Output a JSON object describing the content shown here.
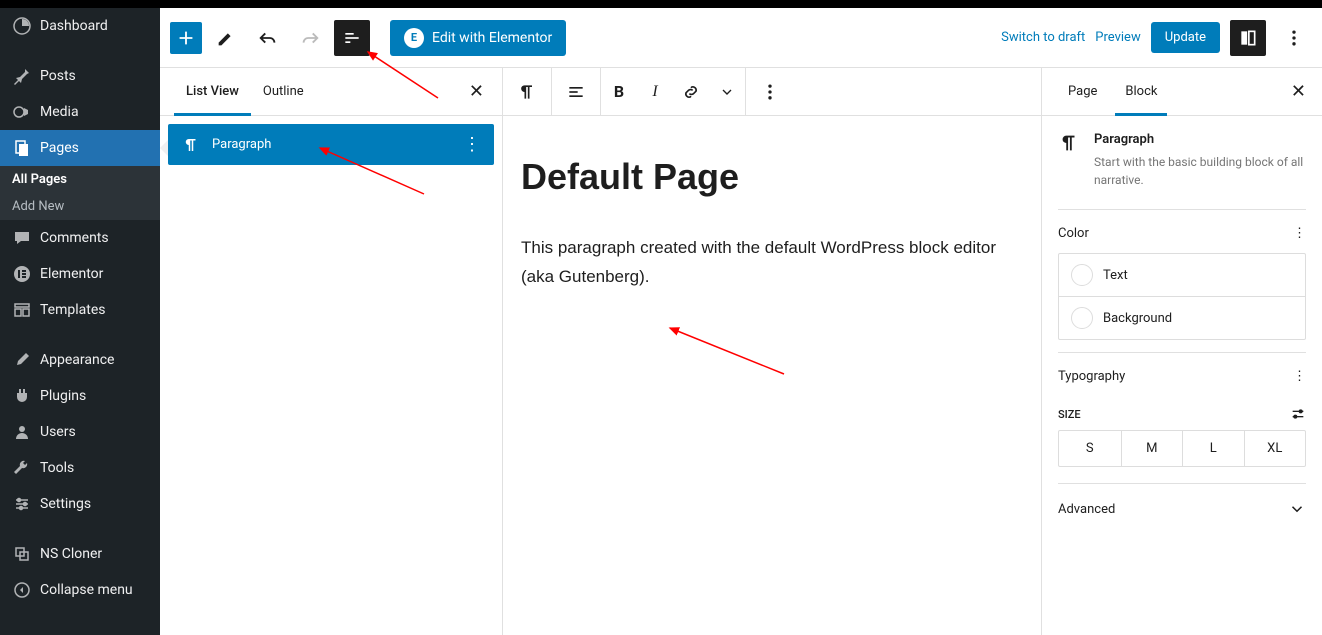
{
  "admin": {
    "items": [
      {
        "name": "dashboard",
        "label": "Dashboard",
        "icon": "dashboard"
      },
      {
        "name": "posts",
        "label": "Posts",
        "icon": "pin"
      },
      {
        "name": "media",
        "label": "Media",
        "icon": "media"
      },
      {
        "name": "pages",
        "label": "Pages",
        "icon": "pages",
        "active": true,
        "sub": [
          {
            "label": "All Pages",
            "current": true
          },
          {
            "label": "Add New"
          }
        ]
      },
      {
        "name": "comments",
        "label": "Comments",
        "icon": "comment"
      },
      {
        "name": "elementor",
        "label": "Elementor",
        "icon": "elementor"
      },
      {
        "name": "templates",
        "label": "Templates",
        "icon": "templates"
      },
      {
        "gap": true
      },
      {
        "name": "appearance",
        "label": "Appearance",
        "icon": "brush"
      },
      {
        "name": "plugins",
        "label": "Plugins",
        "icon": "plug"
      },
      {
        "name": "users",
        "label": "Users",
        "icon": "user"
      },
      {
        "name": "tools",
        "label": "Tools",
        "icon": "wrench"
      },
      {
        "name": "settings",
        "label": "Settings",
        "icon": "sliders"
      },
      {
        "gap": true
      },
      {
        "name": "nscloner",
        "label": "NS Cloner",
        "icon": "cloner"
      },
      {
        "name": "collapse",
        "label": "Collapse menu",
        "icon": "collapse"
      }
    ]
  },
  "toolbar": {
    "elementor_label": "Edit with Elementor",
    "switch_draft": "Switch to draft",
    "preview": "Preview",
    "update": "Update"
  },
  "list_panel": {
    "tab_listview": "List View",
    "tab_outline": "Outline",
    "block_label": "Paragraph"
  },
  "content": {
    "title": "Default Page",
    "paragraph": "This paragraph created with the default WordPress block editor (aka Gutenberg)."
  },
  "settings_panel": {
    "tab_page": "Page",
    "tab_block": "Block",
    "block_name": "Paragraph",
    "block_desc": "Start with the basic building block of all narrative.",
    "color_section": "Color",
    "color_text": "Text",
    "color_bg": "Background",
    "typo_section": "Typography",
    "size_label": "SIZE",
    "sizes": [
      "S",
      "M",
      "L",
      "XL"
    ],
    "advanced": "Advanced"
  }
}
